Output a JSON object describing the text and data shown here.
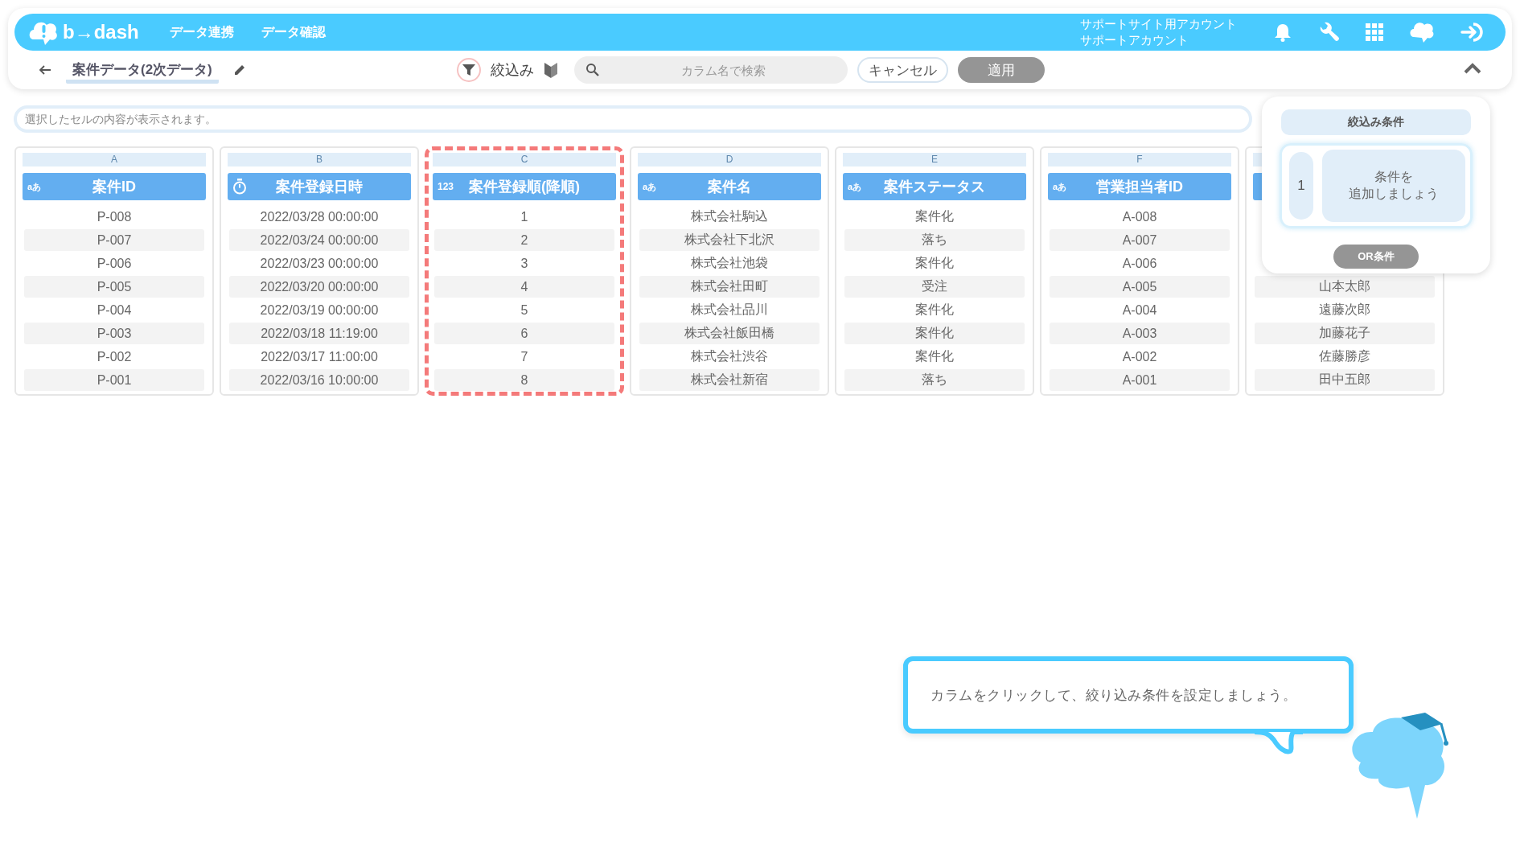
{
  "header": {
    "logo": "b→dash",
    "nav": [
      "データ連携",
      "データ確認"
    ],
    "account": [
      "サポートサイト用アカウント",
      "サポートアカウント"
    ]
  },
  "toolbar": {
    "title": "案件データ(2次データ)",
    "filter_label": "絞込み",
    "search": {
      "placeholder": "カラム名で検索"
    },
    "buttons": [
      {
        "label": "キャンセル",
        "disabled": false
      },
      {
        "label": "適用",
        "disabled": true
      }
    ]
  },
  "cell_viewer": {
    "placeholder": "選択したセルの内容が表示されます。"
  },
  "columns": [
    {
      "letter": "A",
      "kind": "text",
      "type_label": "aあ",
      "title": "案件ID",
      "highlighted": false,
      "cells": [
        "P-008",
        "P-007",
        "P-006",
        "P-005",
        "P-004",
        "P-003",
        "P-002",
        "P-001"
      ]
    },
    {
      "letter": "B",
      "kind": "datetime",
      "title": "案件登録日時",
      "highlighted": false,
      "cells": [
        "2022/03/28 00:00:00",
        "2022/03/24 00:00:00",
        "2022/03/23 00:00:00",
        "2022/03/20 00:00:00",
        "2022/03/19 00:00:00",
        "2022/03/18 11:19:00",
        "2022/03/17 11:00:00",
        "2022/03/16 10:00:00"
      ]
    },
    {
      "letter": "C",
      "kind": "number",
      "type_label": "123",
      "title": "案件登録順(降順)",
      "highlighted": true,
      "cells": [
        "1",
        "2",
        "3",
        "4",
        "5",
        "6",
        "7",
        "8"
      ]
    },
    {
      "letter": "D",
      "kind": "text",
      "type_label": "aあ",
      "title": "案件名",
      "highlighted": false,
      "cells": [
        "株式会社駒込",
        "株式会社下北沢",
        "株式会社池袋",
        "株式会社田町",
        "株式会社品川",
        "株式会社飯田橋",
        "株式会社渋谷",
        "株式会社新宿"
      ]
    },
    {
      "letter": "E",
      "kind": "text",
      "type_label": "aあ",
      "title": "案件ステータス",
      "highlighted": false,
      "cells": [
        "案件化",
        "落ち",
        "案件化",
        "受注",
        "案件化",
        "案件化",
        "案件化",
        "落ち"
      ]
    },
    {
      "letter": "F",
      "kind": "text",
      "type_label": "aあ",
      "title": "営業担当者ID",
      "highlighted": false,
      "cells": [
        "A-008",
        "A-007",
        "A-006",
        "A-005",
        "A-004",
        "A-003",
        "A-002",
        "A-001"
      ]
    },
    {
      "kind": "text",
      "highlighted": false,
      "cells": [
        "山本太郎",
        "遠藤次郎",
        "加藤花子",
        "佐藤勝彦",
        "田中五郎"
      ]
    }
  ],
  "filter_panel": {
    "title": "絞込み条件",
    "conditions": [
      {
        "number": "1",
        "lines": [
          "条件を",
          "追加しましょう"
        ]
      }
    ],
    "or_button": {
      "label": "OR条件",
      "disabled": true
    }
  },
  "hint": {
    "text": "カラムをクリックして、絞り込み条件を設定しましょう。"
  }
}
